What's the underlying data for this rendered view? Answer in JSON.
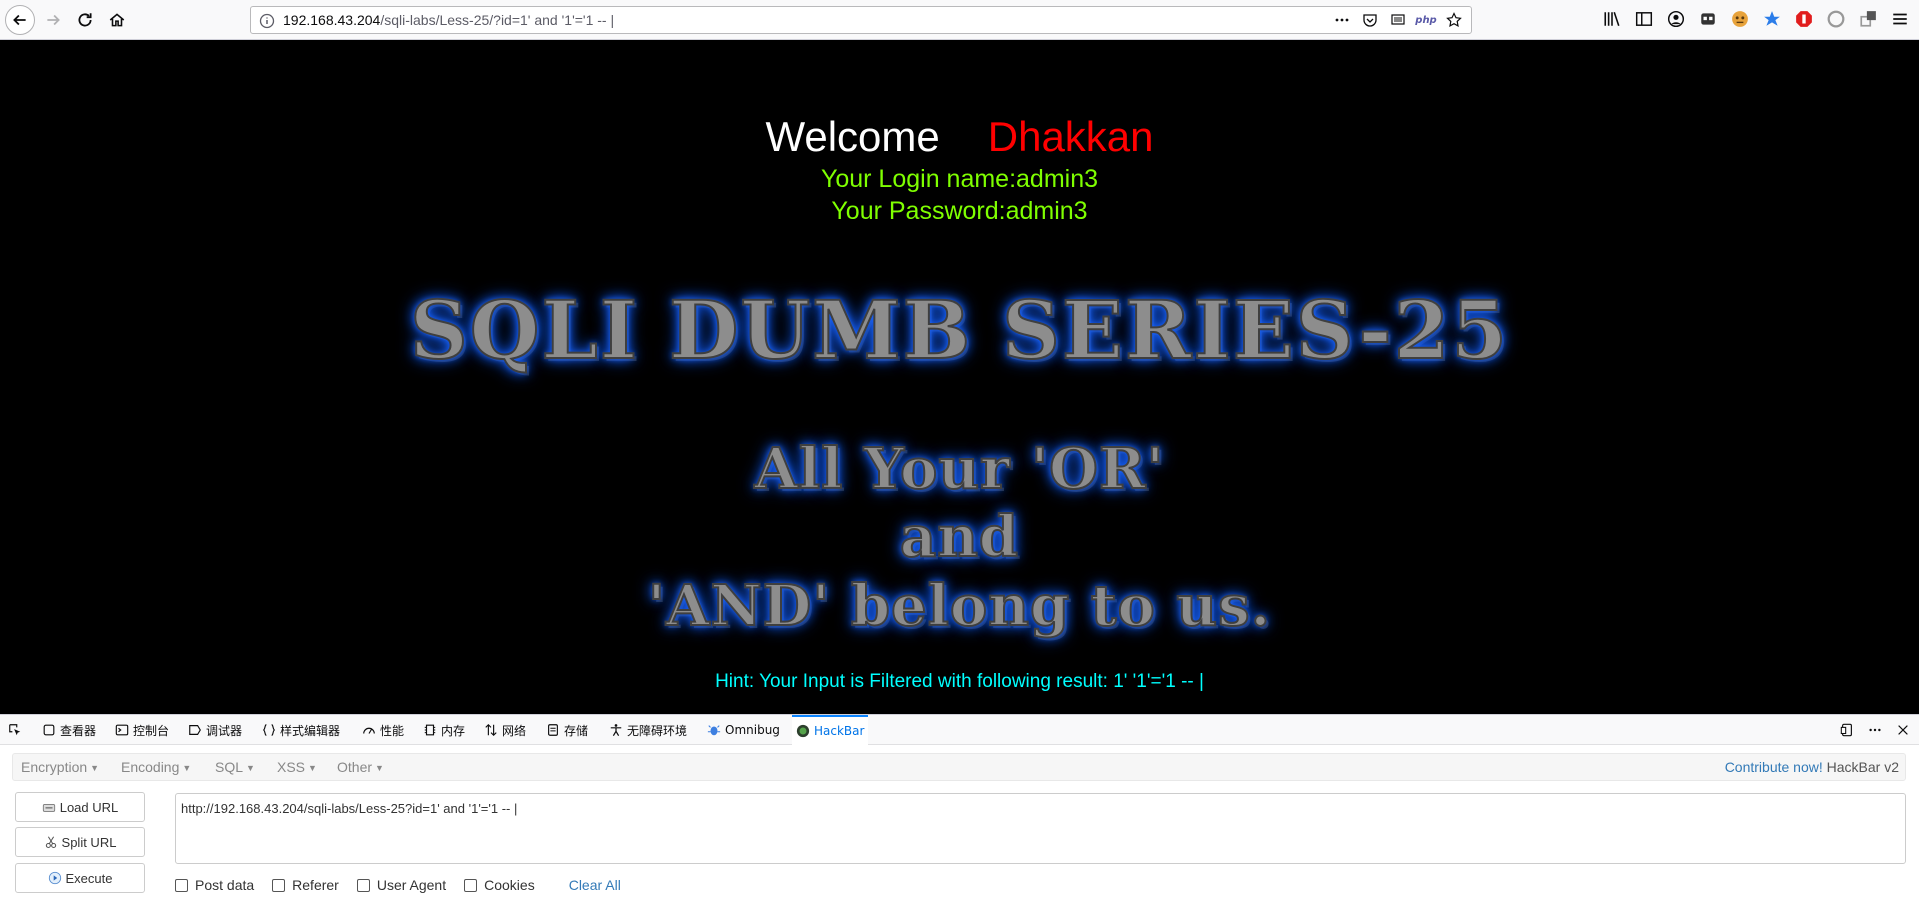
{
  "browser": {
    "url_host": "192.168.43.204",
    "url_path": "/sqli-labs/Less-25/?id=1' and '1'='1 -- |",
    "php_badge": "php"
  },
  "page": {
    "welcome": "Welcome",
    "welcome_name": "Dhakkan",
    "login_name": "Your Login name:admin3",
    "password": "Your Password:admin3",
    "banner_title": "SQLI DUMB SERIES-25",
    "banner_line1": "All Your 'OR'",
    "banner_line2": "and",
    "banner_line3": "'AND' belong to us.",
    "hint": "Hint: Your Input is Filtered with following result: 1' '1'='1 -- |",
    "colors": {
      "welcome": "#ffffff",
      "name": "#ff0000",
      "login": "#7fff00",
      "hint": "#00ffff",
      "banner_glow": "#1a64ff"
    }
  },
  "devtools": {
    "tabs": [
      {
        "label": "查看器",
        "icon": "inspector-icon"
      },
      {
        "label": "控制台",
        "icon": "console-icon"
      },
      {
        "label": "调试器",
        "icon": "debugger-icon"
      },
      {
        "label": "样式编辑器",
        "icon": "style-editor-icon"
      },
      {
        "label": "性能",
        "icon": "performance-icon"
      },
      {
        "label": "内存",
        "icon": "memory-icon"
      },
      {
        "label": "网络",
        "icon": "network-icon"
      },
      {
        "label": "存储",
        "icon": "storage-icon"
      },
      {
        "label": "无障碍环境",
        "icon": "accessibility-icon"
      },
      {
        "label": "Omnibug",
        "icon": "omnibug-icon"
      },
      {
        "label": "HackBar",
        "icon": "hackbar-icon",
        "active": true
      }
    ]
  },
  "hackbar": {
    "menu": [
      "Encryption",
      "Encoding",
      "SQL",
      "XSS",
      "Other"
    ],
    "contribute_link": "Contribute now!",
    "version": "HackBar v2",
    "load_url": "Load URL",
    "split_url": "Split URL",
    "execute": "Execute",
    "url_value": "http://192.168.43.204/sqli-labs/Less-25?id=1' and '1'='1 -- |",
    "options": [
      "Post data",
      "Referer",
      "User Agent",
      "Cookies"
    ],
    "clear_all": "Clear All"
  }
}
